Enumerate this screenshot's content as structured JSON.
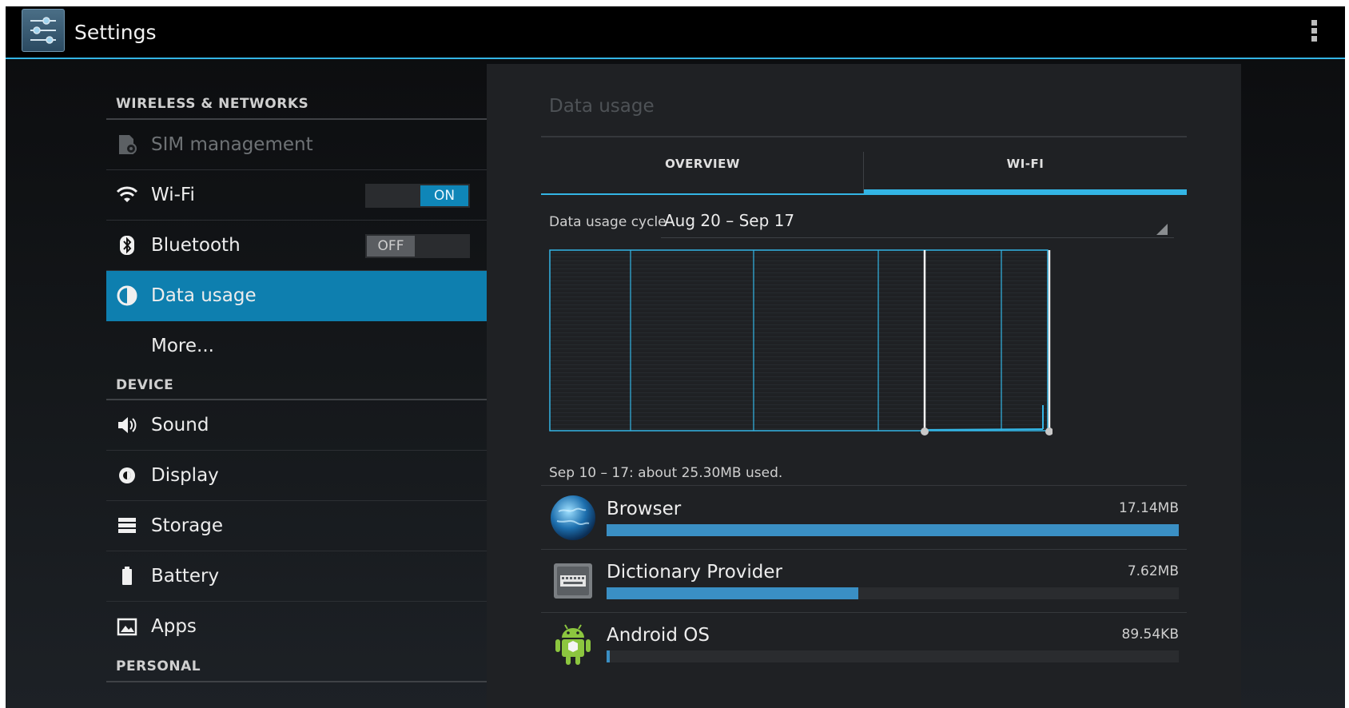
{
  "actionbar": {
    "title": "Settings"
  },
  "sidebar": {
    "sections": {
      "wireless": "WIRELESS & NETWORKS",
      "device": "DEVICE",
      "personal": "PERSONAL"
    },
    "items": [
      {
        "label": "SIM management",
        "state": "disabled"
      },
      {
        "label": "Wi-Fi",
        "toggle": "ON"
      },
      {
        "label": "Bluetooth",
        "toggle": "OFF"
      },
      {
        "label": "Data usage",
        "state": "selected"
      },
      {
        "label": "More..."
      },
      {
        "label": "Sound"
      },
      {
        "label": "Display"
      },
      {
        "label": "Storage"
      },
      {
        "label": "Battery"
      },
      {
        "label": "Apps"
      }
    ]
  },
  "panel": {
    "title": "Data usage",
    "tabs": [
      {
        "label": "OVERVIEW"
      },
      {
        "label": "WI-FI",
        "selected": true
      }
    ],
    "cycle_label": "Data usage cycle",
    "cycle_value": "Aug 20 – Sep 17",
    "summary": "Sep 10 – 17: about 25.30MB used.",
    "apps": [
      {
        "name": "Browser",
        "size": "17.14MB",
        "usage_fraction": 1.0
      },
      {
        "name": "Dictionary Provider",
        "size": "7.62MB",
        "usage_fraction": 0.44
      },
      {
        "name": "Android OS",
        "size": "89.54KB",
        "usage_fraction": 0.005
      }
    ]
  },
  "colors": {
    "accent": "#33b5e5",
    "selected_row": "#0e7faf",
    "usage_bar": "#3a8fc4"
  },
  "icons": [
    "settings-app-icon",
    "overflow-menu-icon",
    "sim-icon",
    "wifi-icon",
    "bluetooth-icon",
    "data-usage-icon",
    "sound-icon",
    "display-icon",
    "storage-icon",
    "battery-icon",
    "apps-icon",
    "browser-globe-icon",
    "keyboard-icon",
    "android-robot-icon"
  ]
}
